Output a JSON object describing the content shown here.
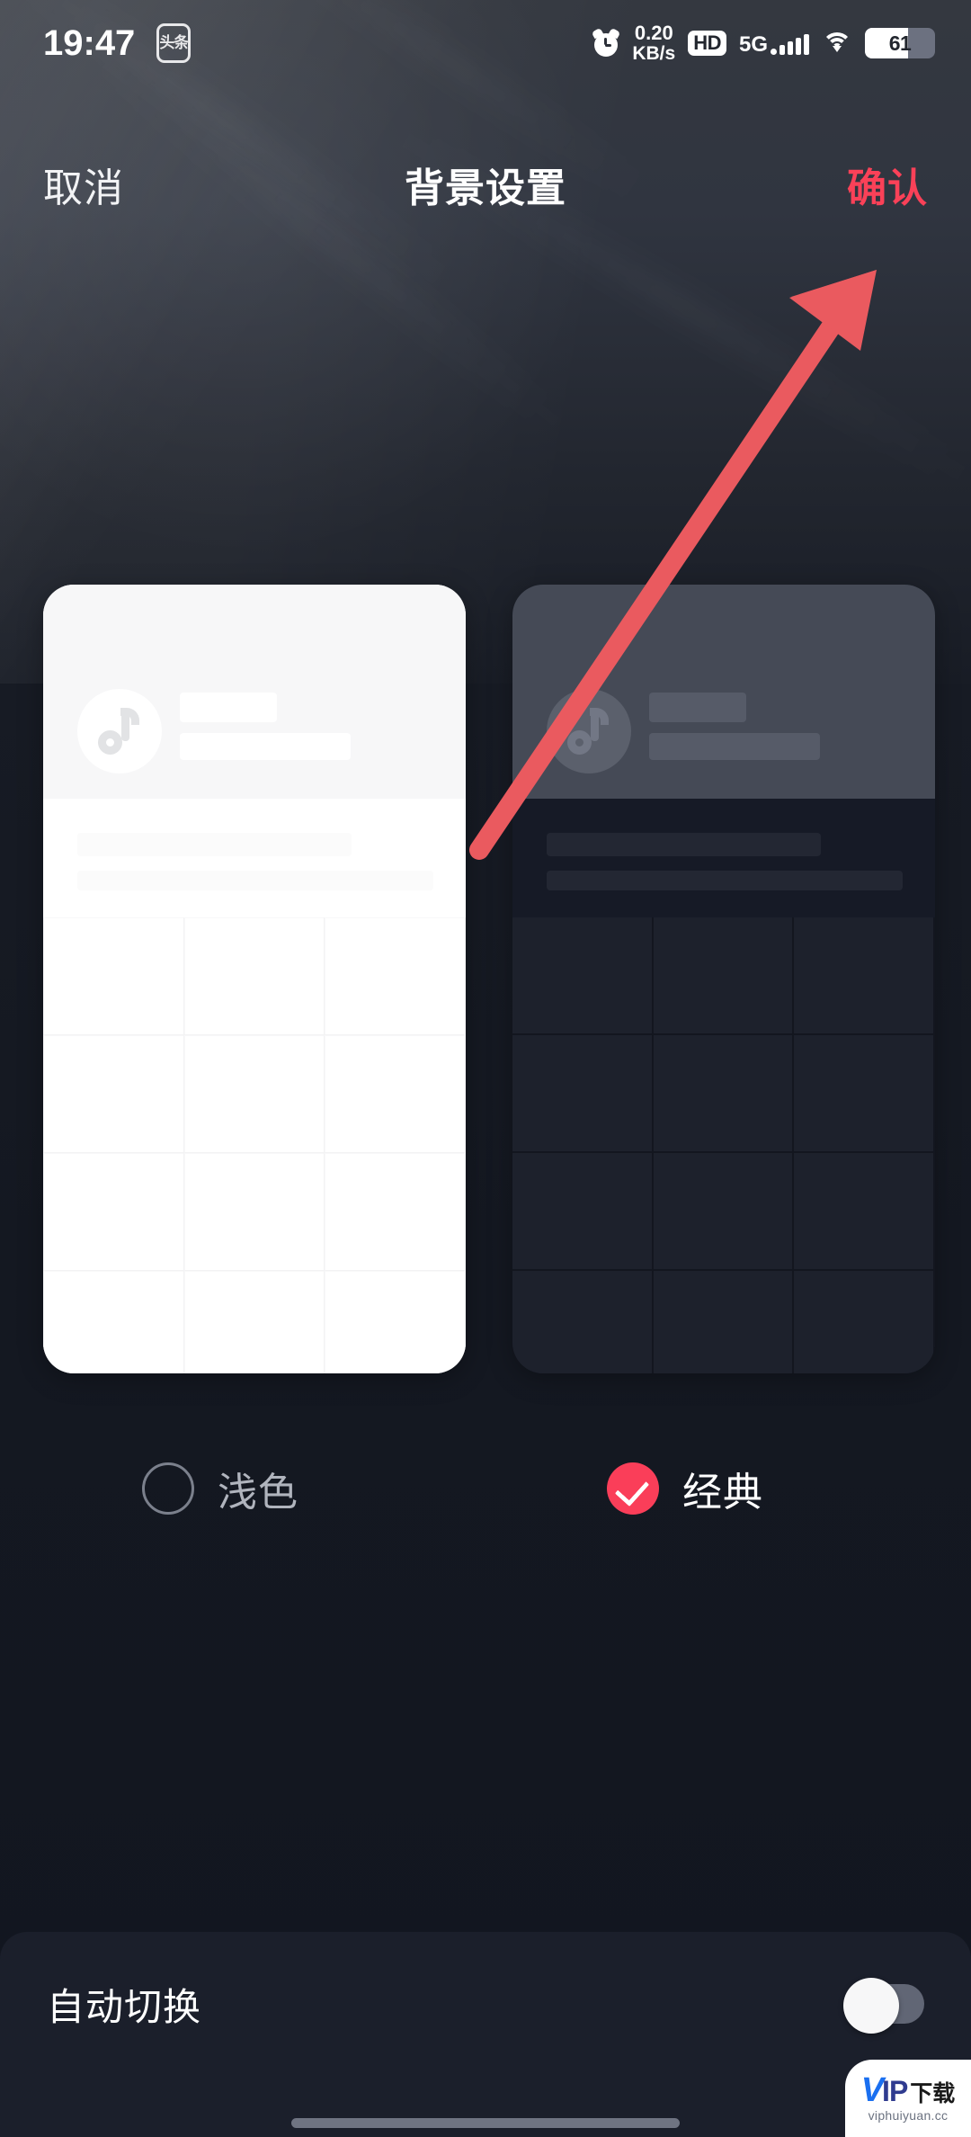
{
  "status_bar": {
    "time": "19:47",
    "app_badge_icon": "toutiao-app-icon",
    "app_badge_text": "头条",
    "alarm_icon": "alarm-clock-icon",
    "network_speed": "0.20",
    "network_speed_unit": "KB/s",
    "hd_badge": "HD",
    "network_type": "5G",
    "signal_icon": "signal-bars-icon",
    "wifi_icon": "wifi-icon",
    "battery_level": "61"
  },
  "header": {
    "cancel_label": "取消",
    "title": "背景设置",
    "confirm_label": "确认",
    "confirm_color": "#fa4158"
  },
  "previews": [
    {
      "id": "light-preview",
      "theme": "light",
      "avatar_icon": "douyin-note-icon",
      "card_bg": "#ffffff",
      "head_bg": "#f7f7f8"
    },
    {
      "id": "classic-preview",
      "theme": "classic",
      "avatar_icon": "douyin-note-icon",
      "card_bg": "#141823",
      "head_bg": "#454a56"
    }
  ],
  "options": [
    {
      "label": "浅色",
      "selected": false,
      "radio_icon": "radio-unchecked-icon"
    },
    {
      "label": "经典",
      "selected": true,
      "radio_icon": "radio-checked-icon",
      "accent": "#fa3e59"
    }
  ],
  "bottom": {
    "auto_switch_label": "自动切换",
    "auto_switch_on": false,
    "toggle_icon": "toggle-switch-off-icon"
  },
  "annotation": {
    "arrow_icon": "red-arrow-icon",
    "arrow_color": "#ea5a5f",
    "points_to": "确认"
  },
  "watermark": {
    "brand_v": "V",
    "brand_ip": "IP",
    "brand_cn": "下载",
    "url": "viphuiyuan.cc"
  },
  "system": {
    "home_indicator": "home-indicator"
  }
}
